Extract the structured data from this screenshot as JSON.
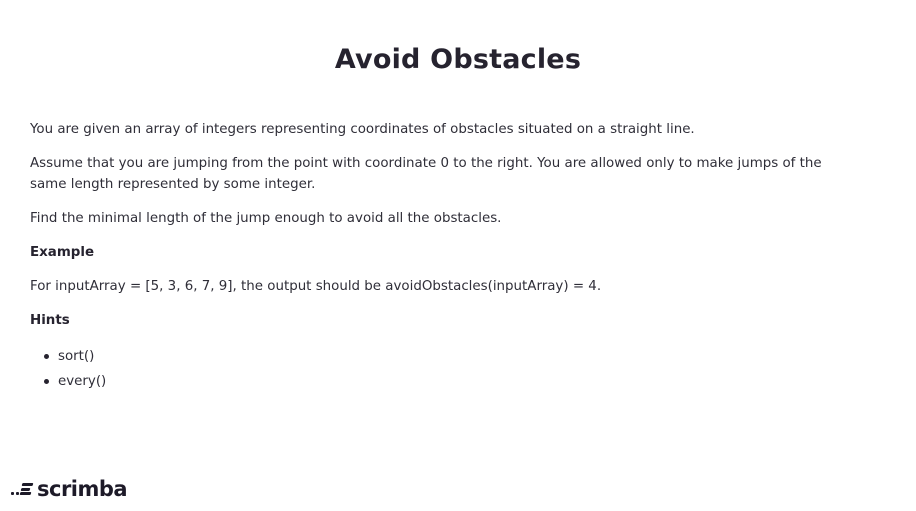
{
  "title": "Avoid Obstacles",
  "paragraphs": {
    "intro": "You are given an array of integers representing coordinates of obstacles situated on a straight line.",
    "assume": "Assume that you are jumping from the point with coordinate 0 to the right. You are allowed only to make jumps of the same length represented by some integer.",
    "task": "Find the minimal length of the jump enough to avoid all the obstacles."
  },
  "example": {
    "heading": "Example",
    "text": "For inputArray = [5, 3, 6, 7, 9], the output should be avoidObstacles(inputArray) = 4."
  },
  "hints": {
    "heading": "Hints",
    "items": [
      "sort()",
      "every()"
    ]
  },
  "logo": {
    "text": "scrimba",
    "icon": "scrimba-logo-icon"
  }
}
